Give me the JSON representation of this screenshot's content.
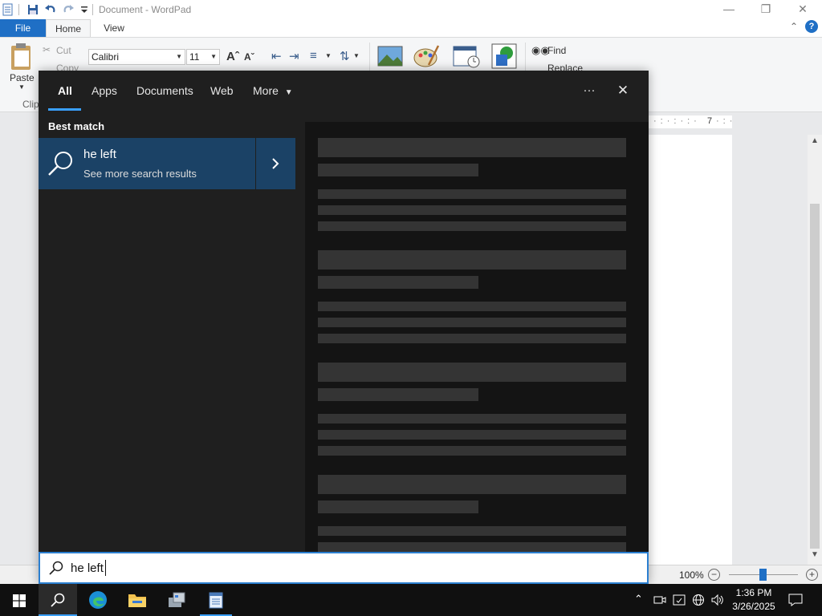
{
  "wordpad": {
    "title": "Document - WordPad",
    "tabs": {
      "file": "File",
      "home": "Home",
      "view": "View"
    },
    "ribbon": {
      "paste_label": "Paste",
      "cut_label": "Cut",
      "copy_label": "Copy",
      "clipboard_group": "Clip",
      "font_name": "Calibri",
      "font_size": "11",
      "find_label": "Find",
      "replace_label": "Replace"
    },
    "ruler_number": "7",
    "zoom": "100%"
  },
  "search": {
    "tabs": [
      "All",
      "Apps",
      "Documents",
      "Web",
      "More"
    ],
    "best_match_heading": "Best match",
    "result_title": "he left",
    "result_subtitle": "See more search results",
    "query": "he left",
    "more_options_label": "···",
    "close_label": "✕"
  },
  "taskbar": {
    "time": "1:36 PM",
    "date": "3/26/2025"
  },
  "colors": {
    "accent": "#3aa0ff",
    "selection": "#1b4266",
    "file_tab": "#1f6fc5"
  }
}
